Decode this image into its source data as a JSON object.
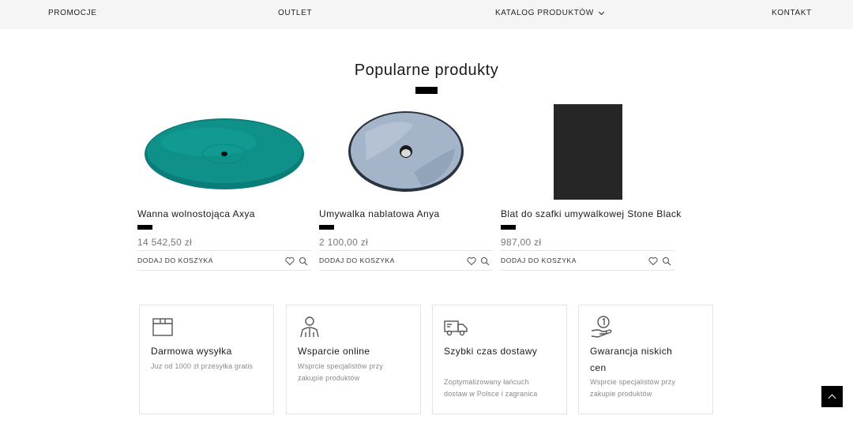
{
  "nav": {
    "items": [
      {
        "label": "PROMOCJE"
      },
      {
        "label": "OUTLET"
      },
      {
        "label": "KATALOG PRODUKTÓW",
        "icon": "chevron-down-icon"
      },
      {
        "label": "KONTAKT"
      }
    ]
  },
  "section": {
    "title": "Popularne produkty"
  },
  "products": [
    {
      "name": "Wanna wolnostojąca Axya",
      "price": "14 542,50 zł",
      "add_to_cart": "DODAJ DO KOSZYKA",
      "image_color": "#0e8a84"
    },
    {
      "name": "Umywalka nablatowa Anya",
      "price": "2 100,00 zł",
      "add_to_cart": "DODAJ DO KOSZYKA",
      "image_color": "#9fb1c7"
    },
    {
      "name": "Blat do szafki umywalkowej Stone Black",
      "price": "987,00 zł",
      "add_to_cart": "DODAJ DO KOSZYKA",
      "image_color": "#262626"
    }
  ],
  "features": [
    {
      "icon": "box-icon",
      "title": "Darmowa wysyłka",
      "description": "Juz od 1000 zł przesyłka gratis"
    },
    {
      "icon": "support-person-icon",
      "title": "Wsparcie online",
      "description": "Wsprcie specjalistów przy zakupie produktów"
    },
    {
      "icon": "delivery-truck-icon",
      "title": "Szybki czas dostawy",
      "description": "Zoptymalizowany łańcuch dostaw w Polsce i zagranica"
    },
    {
      "icon": "coin-hand-icon",
      "title": "Gwarancja niskich cen",
      "description": "Wsprcie specjalistów przy zakupie produktów"
    }
  ],
  "scroll_top": {
    "icon": "chevron-up-icon"
  }
}
